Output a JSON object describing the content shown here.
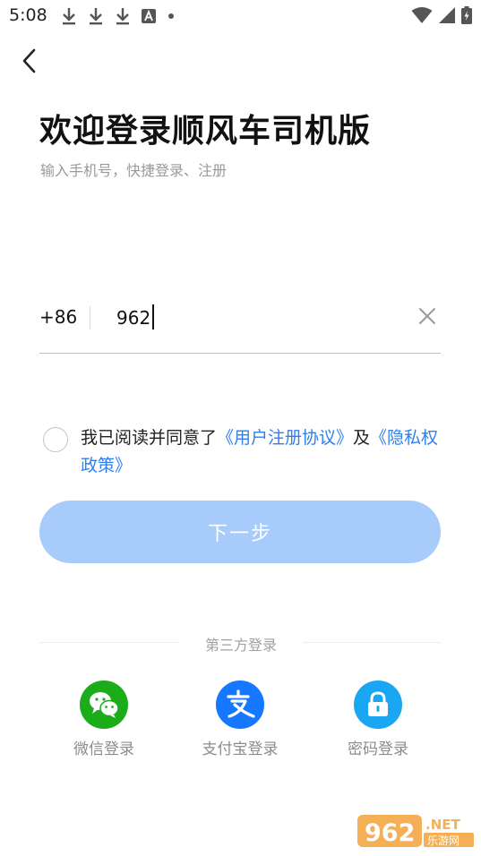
{
  "status_bar": {
    "time": "5:08",
    "icons": [
      "download-icon",
      "download-icon",
      "download-icon",
      "font-icon",
      "dot-icon",
      "wifi-icon",
      "signal-icon",
      "battery-icon"
    ]
  },
  "header": {
    "title": "欢迎登录顺风车司机版",
    "subtitle": "输入手机号，快捷登录、注册"
  },
  "phone": {
    "country_code": "+86",
    "value": "962"
  },
  "agreement": {
    "prefix": "我已阅读并同意了",
    "user_agreement": "《用户注册协议》",
    "joiner": "及",
    "privacy_policy": "《隐私权政策》"
  },
  "next_button": {
    "label": "下一步"
  },
  "third_party": {
    "label": "第三方登录",
    "options": [
      {
        "label": "微信登录",
        "icon": "wechat-icon",
        "color": "#1aad19"
      },
      {
        "label": "支付宝登录",
        "icon": "alipay-icon",
        "color": "#1677ff"
      },
      {
        "label": "密码登录",
        "icon": "lock-icon",
        "color": "#1aa6f2"
      }
    ]
  },
  "colors": {
    "accent": "#2f80ed",
    "button_disabled": "#a7cbfb"
  }
}
